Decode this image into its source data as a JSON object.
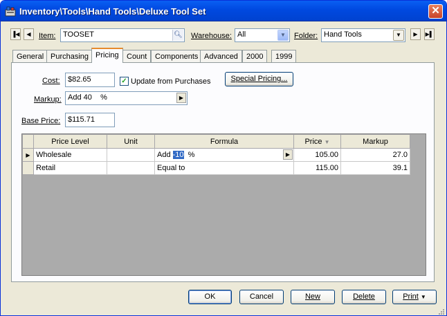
{
  "window": {
    "title": "Inventory\\Tools\\Hand Tools\\Deluxe Tool Set"
  },
  "toolbar": {
    "item_label": "Item:",
    "item_value": "TOOSET",
    "warehouse_label": "Warehouse:",
    "warehouse_value": "All",
    "folder_label": "Folder:",
    "folder_value": "Hand Tools"
  },
  "tabs": [
    "General",
    "Purchasing",
    "Pricing",
    "Count",
    "Components",
    "Advanced",
    "2000",
    "1999"
  ],
  "active_tab": "Pricing",
  "pricing": {
    "cost_label": "Cost:",
    "cost_value": "$82.65",
    "update_label": "Update from Purchases",
    "update_checked": true,
    "special_pricing_label": "Special Pricing...",
    "markup_label": "Markup:",
    "markup_value": "Add 40",
    "markup_unit": "%",
    "base_price_label": "Base Price:",
    "base_price_value": "$115.71"
  },
  "grid": {
    "columns": [
      "Price Level",
      "Unit",
      "Formula",
      "Price",
      "Markup"
    ],
    "rows": [
      {
        "price_level": "Wholesale",
        "unit": "",
        "formula_prefix": "Add",
        "formula_value": "-10",
        "formula_unit": "%",
        "price": "105.00",
        "markup": "27.0",
        "current": true
      },
      {
        "price_level": "Retail",
        "unit": "",
        "formula_prefix": "Equal to",
        "formula_value": "",
        "formula_unit": "",
        "price": "115.00",
        "markup": "39.1",
        "current": false
      }
    ]
  },
  "buttons": {
    "ok": "OK",
    "cancel": "Cancel",
    "new": "New",
    "delete": "Delete",
    "print": "Print"
  },
  "colors": {
    "titlebar": "#0a5ff3",
    "tab_highlight": "#e68b2c",
    "selection": "#316ac5",
    "face": "#ece9d8"
  }
}
